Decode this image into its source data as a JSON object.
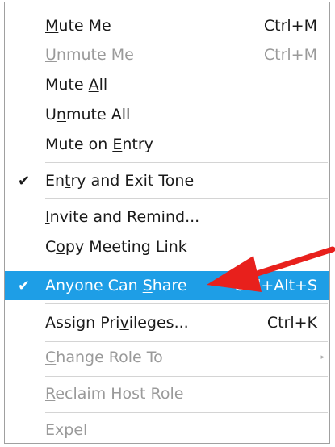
{
  "menu": {
    "items": [
      {
        "pre": "",
        "mn": "M",
        "post": "ute Me",
        "shortcut": "Ctrl+M",
        "enabled": true,
        "checked": false
      },
      {
        "pre": "",
        "mn": "U",
        "post": "nmute Me",
        "shortcut": "Ctrl+M",
        "enabled": false,
        "checked": false
      },
      {
        "pre": "Mute ",
        "mn": "A",
        "post": "ll",
        "shortcut": "",
        "enabled": true,
        "checked": false
      },
      {
        "pre": "U",
        "mn": "n",
        "post": "mute All",
        "shortcut": "",
        "enabled": true,
        "checked": false
      },
      {
        "pre": "Mute on ",
        "mn": "E",
        "post": "ntry",
        "shortcut": "",
        "enabled": true,
        "checked": false
      },
      {
        "pre": "En",
        "mn": "t",
        "post": "ry and Exit Tone",
        "shortcut": "",
        "enabled": true,
        "checked": true
      },
      {
        "pre": "",
        "mn": "I",
        "post": "nvite and Remind...",
        "shortcut": "",
        "enabled": true,
        "checked": false
      },
      {
        "pre": "C",
        "mn": "o",
        "post": "py Meeting Link",
        "shortcut": "",
        "enabled": true,
        "checked": false
      },
      {
        "pre": "Anyone Can ",
        "mn": "S",
        "post": "hare",
        "shortcut": "Ctrl+Alt+S",
        "enabled": true,
        "checked": true,
        "highlighted": true
      },
      {
        "pre": "Assign Pri",
        "mn": "v",
        "post": "ileges...",
        "shortcut": "Ctrl+K",
        "enabled": true,
        "checked": false
      },
      {
        "pre": "",
        "mn": "C",
        "post": "hange Role To",
        "shortcut": "",
        "enabled": false,
        "checked": false,
        "submenu": true
      },
      {
        "pre": "",
        "mn": "R",
        "post": "eclaim Host Role",
        "shortcut": "",
        "enabled": false,
        "checked": false
      },
      {
        "pre": "Ex",
        "mn": "p",
        "post": "el",
        "shortcut": "",
        "enabled": false,
        "checked": false
      }
    ]
  },
  "icons": {
    "checkmark": "✔",
    "submenu": "▸"
  },
  "colors": {
    "highlight": "#1e9ee6",
    "arrow": "#e8201c",
    "disabled": "#9a9a9a"
  }
}
